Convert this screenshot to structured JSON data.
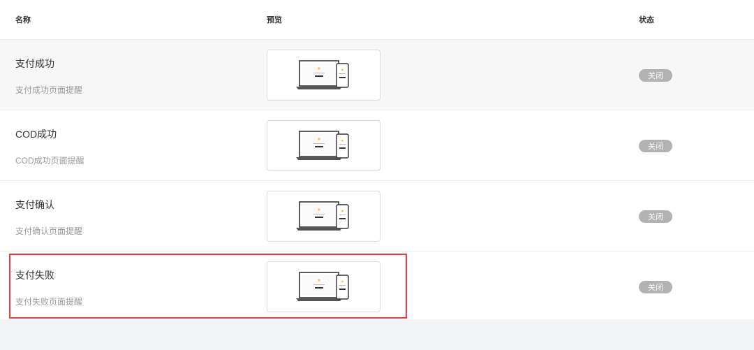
{
  "header": {
    "name": "名称",
    "preview": "预览",
    "status": "状态"
  },
  "rows": [
    {
      "title": "支付成功",
      "desc": "支付成功页面提醒",
      "status": "关闭",
      "highlighted": false
    },
    {
      "title": "COD成功",
      "desc": "COD成功页面提醒",
      "status": "关闭",
      "highlighted": false
    },
    {
      "title": "支付确认",
      "desc": "支付确认页面提醒",
      "status": "关闭",
      "highlighted": false
    },
    {
      "title": "支付失败",
      "desc": "支付失败页面提醒",
      "status": "关闭",
      "highlighted": true
    }
  ],
  "colors": {
    "status_off": "#b2b2b2",
    "highlight": "#e53e45",
    "preview_accent": "#f3c242"
  }
}
